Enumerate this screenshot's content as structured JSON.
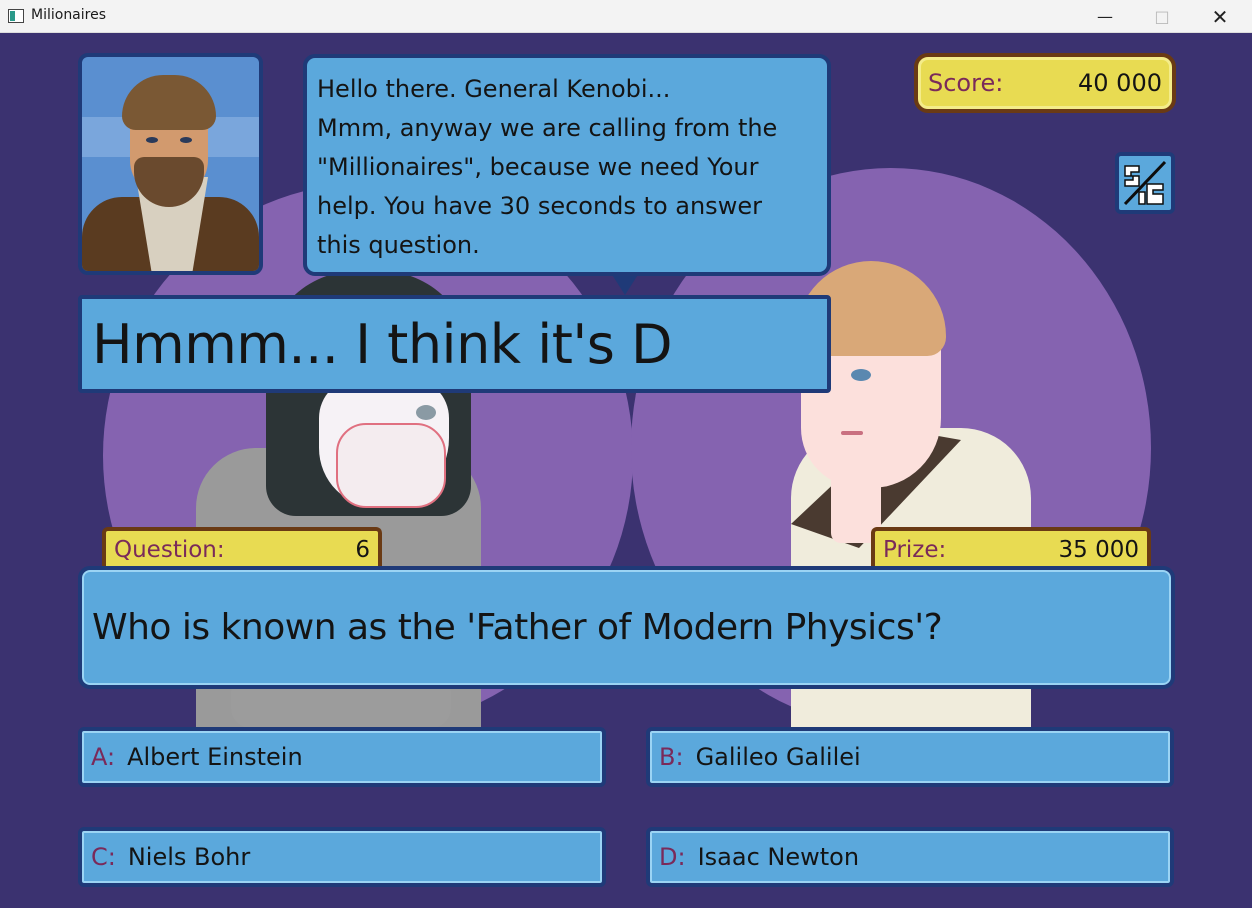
{
  "window": {
    "title": "Milionaires",
    "minimize_icon": "minimize-icon",
    "maximize_icon": "maximize-icon",
    "close_icon": "close-icon"
  },
  "host": {
    "portrait_icon": "host-portrait",
    "speech": "Hello there. General Kenobi...\nMmm, anyway we are calling from the\n\"Millionaires\", because we need Your\nhelp. You have 30 seconds to answer\nthis question."
  },
  "hint": {
    "text": "Hmmm... I think it's D"
  },
  "score": {
    "label": "Score:",
    "value": "40 000"
  },
  "lifeline": {
    "icon": "fifty-fifty-icon"
  },
  "question_info": {
    "label": "Question:",
    "number": "6"
  },
  "prize": {
    "label": "Prize:",
    "value": "35 000"
  },
  "question": {
    "text": "Who is known as the 'Father of Modern Physics'?"
  },
  "answers": [
    {
      "letter": "A:",
      "text": "Albert Einstein"
    },
    {
      "letter": "B:",
      "text": "Galileo Galilei"
    },
    {
      "letter": "C:",
      "text": "Niels Bohr"
    },
    {
      "letter": "D:",
      "text": "Isaac Newton"
    }
  ],
  "colors": {
    "background": "#3b3270",
    "circle": "#8563b0",
    "panel": "#5ba8dc",
    "panel_border": "#1f3a78",
    "gold": "#e8db52",
    "gold_border": "#6a3a14",
    "label_accent": "#7a2a5a"
  }
}
